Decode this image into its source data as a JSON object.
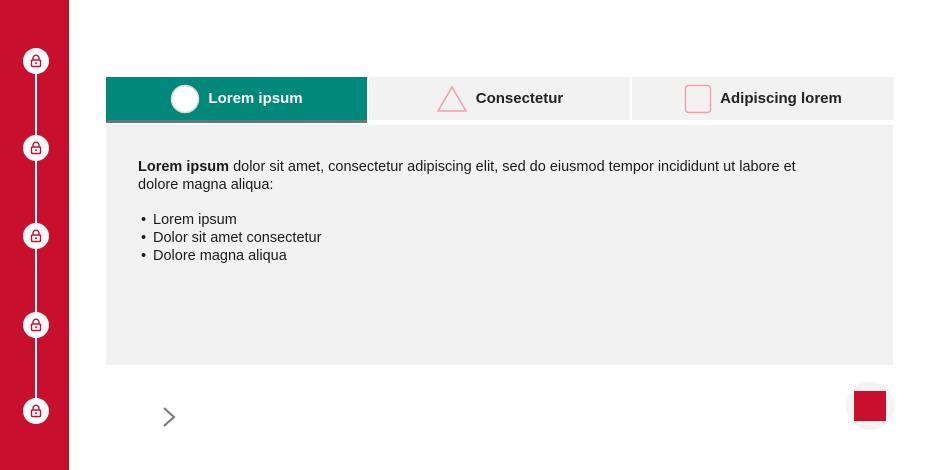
{
  "sidebar": {
    "nodes": [
      "lock-icon",
      "lock-icon",
      "lock-icon",
      "lock-icon",
      "lock-icon"
    ],
    "color": "#c8102e"
  },
  "tabs": [
    {
      "label": "Lorem ipsum",
      "icon": "circle-icon",
      "active": true
    },
    {
      "label": "Consectetur",
      "icon": "triangle-icon",
      "active": false
    },
    {
      "label": "Adipiscing lorem",
      "icon": "square-icon",
      "active": false
    }
  ],
  "content": {
    "lead_bold": "Lorem ipsum",
    "lead_text": " dolor sit amet, consectetur adipiscing elit, sed do eiusmod tempor incididunt ut labore et dolore magna aliqua:",
    "bullets": [
      "Lorem ipsum",
      "Dolor sit amet consectetur",
      "Dolore magna aliqua"
    ]
  },
  "controls": {
    "next_icon": "chevron-right-icon",
    "stop_icon": "stop-icon"
  },
  "colors": {
    "accent_red": "#c8102e",
    "accent_teal": "#00897b",
    "panel_gray": "#f2f2f2"
  }
}
